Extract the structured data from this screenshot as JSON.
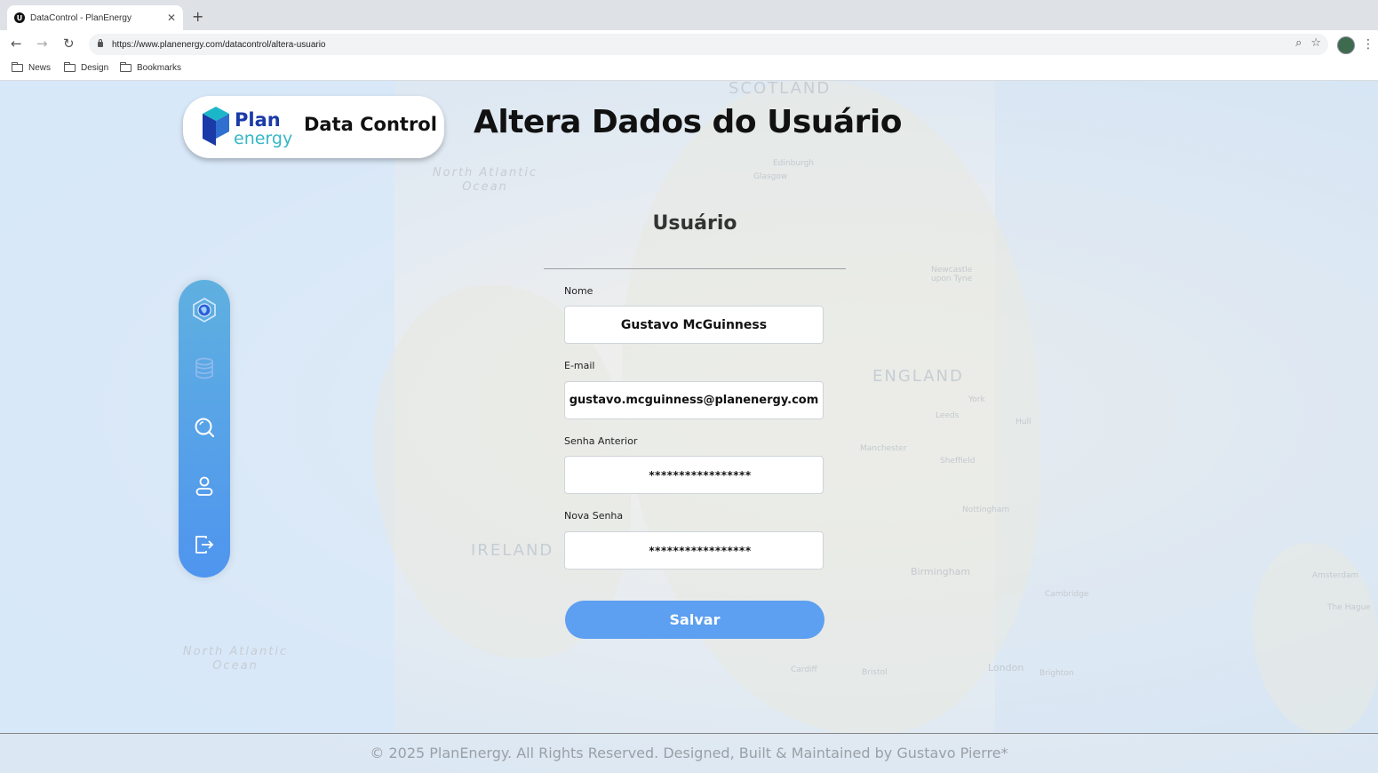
{
  "browser": {
    "tab_title": "DataControl - PlanEnergy",
    "tab_favicon": "U",
    "url": "https://www.planenergy.com/datacontrol/altera-usuario",
    "bookmarks": [
      "News",
      "Design",
      "Bookmarks"
    ]
  },
  "header": {
    "logo_plan": "Plan",
    "logo_energy": "energy",
    "logo_product": "Data Control",
    "page_title": "Altera Dados do Usuário"
  },
  "map_labels": {
    "scotland": "SCOTLAND",
    "england": "ENGLAND",
    "ireland": "IRELAND",
    "north_atlantic_top": "North Atlantic Ocean",
    "north_atlantic_bottom": "North Atlantic Ocean",
    "edinburgh": "Edinburgh",
    "glasgow": "Glasgow",
    "newcastle": "Newcastle upon Tyne",
    "leeds": "Leeds",
    "manchester": "Manchester",
    "sheffield": "Sheffield",
    "birmingham": "Birmingham",
    "london": "London",
    "cambridge": "Cambridge",
    "amsterdam": "Amsterdam",
    "hull": "Hull",
    "york": "York",
    "nottingham": "Nottingham",
    "cardiff": "Cardiff",
    "bristol": "Bristol",
    "the_hague": "The Hague",
    "brighton": "Brighton"
  },
  "sidebar": {
    "items": [
      {
        "name": "globe-icon"
      },
      {
        "name": "database-icon"
      },
      {
        "name": "search-icon"
      },
      {
        "name": "user-icon"
      },
      {
        "name": "logout-icon"
      }
    ]
  },
  "form": {
    "section_title": "Usuário",
    "nome_label": "Nome",
    "nome_value": "Gustavo McGuinness",
    "email_label": "E-mail",
    "email_value": "gustavo.mcguinness@planenergy.com",
    "senha_anterior_label": "Senha Anterior",
    "senha_anterior_value": "*****************",
    "nova_senha_label": "Nova Senha",
    "nova_senha_value": "*****************",
    "save_label": "Salvar"
  },
  "footer": {
    "text": "© 2025 PlanEnergy. All Rights Reserved. Designed, Built & Maintained by Gustavo Pierre*"
  },
  "colors": {
    "accent": "#5d9ff0",
    "sidebar_top": "#5fb0e0",
    "sidebar_bottom": "#4f95ef",
    "logo_blue": "#1a3aa8",
    "logo_teal": "#36b6c6"
  }
}
